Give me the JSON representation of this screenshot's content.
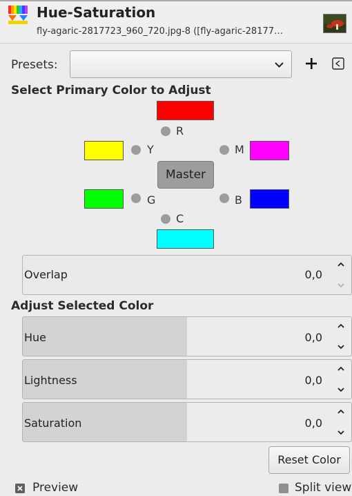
{
  "header": {
    "title": "Hue-Saturation",
    "subtitle": "fly-agaric-2817723_960_720.jpg-8 ([fly-agaric-28177…"
  },
  "presets": {
    "label": "Presets:",
    "value": ""
  },
  "primary": {
    "heading": "Select Primary Color to Adjust",
    "master_label": "Master",
    "colors": [
      {
        "key": "R",
        "color": "#ff0000"
      },
      {
        "key": "Y",
        "color": "#ffff00"
      },
      {
        "key": "M",
        "color": "#ff00ff"
      },
      {
        "key": "G",
        "color": "#00ff00"
      },
      {
        "key": "B",
        "color": "#0000ff"
      },
      {
        "key": "C",
        "color": "#00ffff"
      }
    ]
  },
  "overlap": {
    "label": "Overlap",
    "value": "0,0"
  },
  "adjust": {
    "heading": "Adjust Selected Color",
    "hue": {
      "label": "Hue",
      "value": "0,0",
      "level": 0.5
    },
    "lightness": {
      "label": "Lightness",
      "value": "0,0",
      "level": 0.5
    },
    "saturation": {
      "label": "Saturation",
      "value": "0,0",
      "level": 0.5
    }
  },
  "reset_label": "Reset Color",
  "preview": {
    "label": "Preview",
    "checked": true
  },
  "split_view": {
    "label": "Split view",
    "checked": false
  }
}
